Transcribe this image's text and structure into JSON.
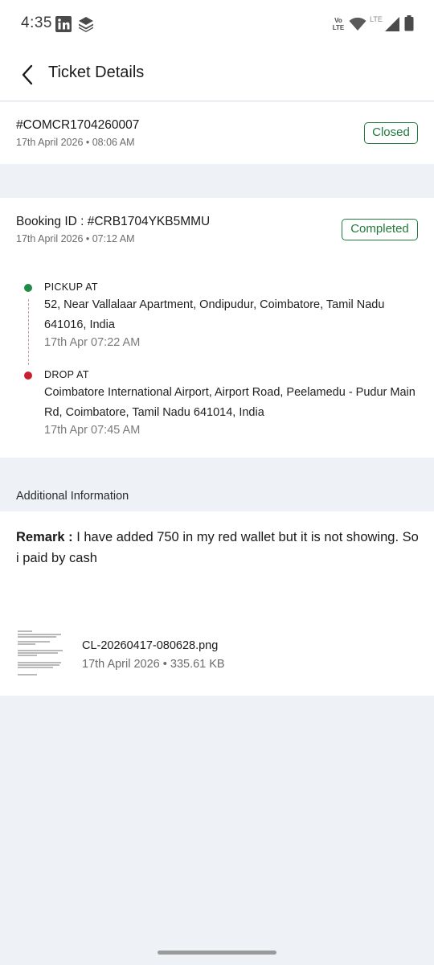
{
  "status_bar": {
    "time": "4:35",
    "network_label_top": "Vo",
    "network_label_bottom": "LTE",
    "lte_label": "LTE",
    "icons": [
      "linkedin-icon",
      "layers-icon",
      "wifi-icon",
      "signal-icon",
      "battery-icon"
    ]
  },
  "header": {
    "title": "Ticket Details",
    "back_icon": "chevron-left-icon"
  },
  "ticket": {
    "id": "#COMCR1704260007",
    "datetime": "17th April 2026 • 08:06 AM",
    "status": "Closed"
  },
  "booking": {
    "id_label": "Booking ID : #CRB1704YKB5MMU",
    "datetime": "17th April 2026 • 07:12 AM",
    "status": "Completed",
    "pickup": {
      "label": "PICKUP AT",
      "address": "52, Near Vallalaar Apartment, Ondipudur, Coimbatore, Tamil Nadu 641016, India",
      "time": "17th Apr 07:22 AM"
    },
    "drop": {
      "label": "DROP AT",
      "address": "Coimbatore International Airport, Airport Road, Peelamedu - Pudur Main Rd, Coimbatore, Tamil Nadu 641014, India",
      "time": "17th Apr 07:45 AM"
    }
  },
  "additional": {
    "section_title": "Additional Information",
    "remark_prefix": "Remark :",
    "remark_text": " I have added 750 in my red wallet but it is not showing. So i paid by cash",
    "attachment": {
      "name": "CL-20260417-080628.png",
      "meta": "17th April 2026 • 335.61 KB"
    }
  },
  "colors": {
    "accent_green": "#1f7a3b",
    "pickup_dot": "#1e8c45",
    "drop_dot": "#c8202e",
    "background": "#eef1f6"
  }
}
